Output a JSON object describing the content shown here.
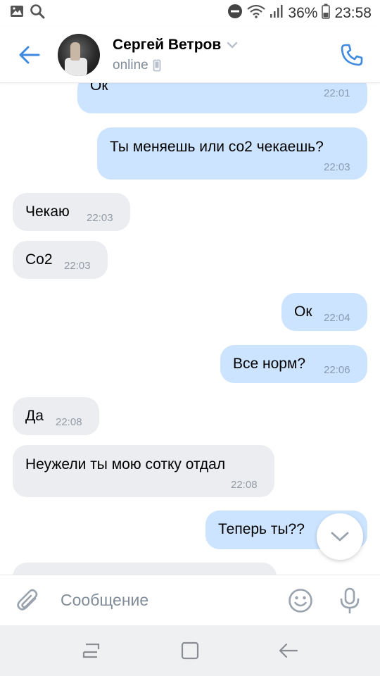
{
  "status_bar": {
    "battery": "36%",
    "time": "23:58",
    "icons": [
      "gallery-icon",
      "search-icon",
      "dnd-icon",
      "wifi-icon",
      "signal-icon",
      "battery-icon"
    ]
  },
  "header": {
    "contact_name": "Сергей Ветров",
    "status": "online",
    "icons": [
      "back-arrow-icon",
      "chevron-down-icon",
      "mobile-icon",
      "phone-icon"
    ]
  },
  "messages": [
    {
      "direction": "out",
      "text": "Ок",
      "time": "22:01"
    },
    {
      "direction": "out",
      "text": "Ты меняешь или со2 чекаешь?",
      "time": "22:03"
    },
    {
      "direction": "in",
      "text": "Чекаю",
      "time": "22:03"
    },
    {
      "direction": "in",
      "text": "Со2",
      "time": "22:03"
    },
    {
      "direction": "out",
      "text": "Ок",
      "time": "22:04"
    },
    {
      "direction": "out",
      "text": "Все норм?",
      "time": "22:06"
    },
    {
      "direction": "in",
      "text": "Да",
      "time": "22:08"
    },
    {
      "direction": "in",
      "text": "Неужели ты мою сотку отдал",
      "time": "22:08"
    },
    {
      "direction": "out",
      "text": "Теперь ты??",
      "time": ""
    }
  ],
  "composer": {
    "placeholder": "Сообщение",
    "icons": [
      "paperclip-icon",
      "emoji-icon",
      "microphone-icon"
    ]
  },
  "nav": {
    "icons": [
      "recent-apps-icon",
      "home-icon",
      "back-icon"
    ]
  },
  "colors": {
    "accent": "#3f8ae0",
    "outgoing_bubble": "#cce4ff",
    "incoming_bubble": "#ebedf0",
    "time_text": "#8a9bb0"
  }
}
